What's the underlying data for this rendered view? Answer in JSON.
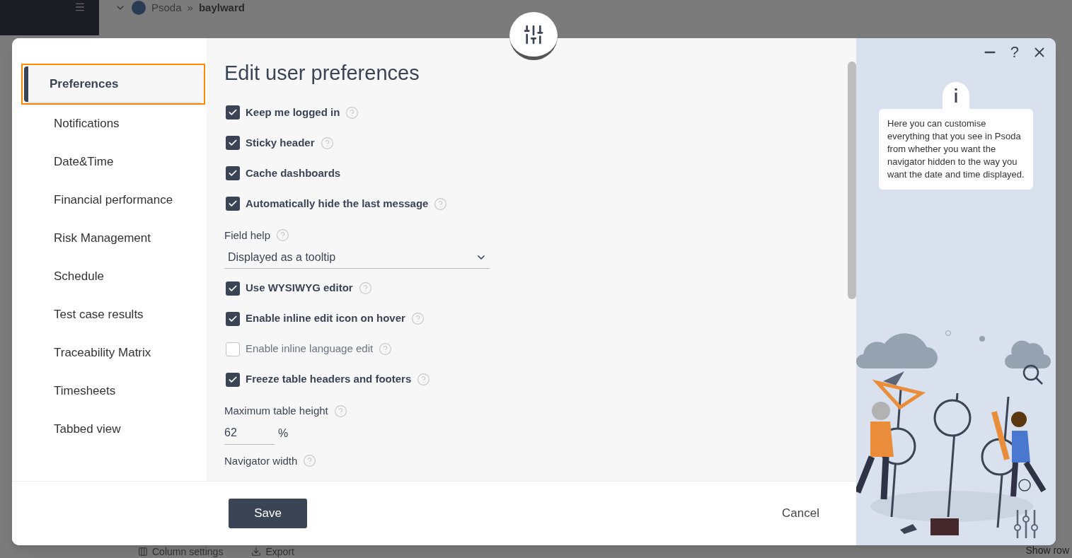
{
  "background": {
    "breadcrumb": [
      "Psoda",
      "»",
      "baylward"
    ],
    "toolbar": [
      "Column settings",
      "Export",
      "Show row"
    ]
  },
  "dialog": {
    "title": "Edit user preferences",
    "nav": [
      {
        "label": "Preferences",
        "selected": true
      },
      {
        "label": "Notifications",
        "selected": false
      },
      {
        "label": "Date&Time",
        "selected": false
      },
      {
        "label": "Financial performance",
        "selected": false
      },
      {
        "label": "Risk Management",
        "selected": false
      },
      {
        "label": "Schedule",
        "selected": false
      },
      {
        "label": "Test case results",
        "selected": false
      },
      {
        "label": "Traceability Matrix",
        "selected": false
      },
      {
        "label": "Timesheets",
        "selected": false
      },
      {
        "label": "Tabbed view",
        "selected": false
      }
    ],
    "fields": [
      {
        "kind": "checkbox",
        "label": "Keep me logged in",
        "checked": true,
        "help": true
      },
      {
        "kind": "checkbox",
        "label": "Sticky header",
        "checked": true,
        "help": true
      },
      {
        "kind": "checkbox",
        "label": "Cache dashboards",
        "checked": true,
        "help": false
      },
      {
        "kind": "checkbox",
        "label": "Automatically hide the last message",
        "checked": true,
        "help": true
      },
      {
        "kind": "select",
        "label": "Field help",
        "value": "Displayed as a tooltip",
        "help": true
      },
      {
        "kind": "checkbox",
        "label": "Use WYSIWYG editor",
        "checked": true,
        "help": true
      },
      {
        "kind": "checkbox",
        "label": "Enable inline edit icon on hover",
        "checked": true,
        "help": true
      },
      {
        "kind": "checkbox",
        "label": "Enable inline language edit",
        "checked": false,
        "help": true
      },
      {
        "kind": "checkbox",
        "label": "Freeze table headers and footers",
        "checked": true,
        "help": true
      },
      {
        "kind": "number",
        "label": "Maximum table height",
        "value": "62",
        "unit": "%",
        "help": true
      },
      {
        "kind": "label",
        "label": "Navigator width",
        "help": true
      }
    ],
    "buttons": {
      "save": "Save",
      "cancel": "Cancel"
    },
    "window_controls": {
      "help": "?"
    },
    "info": "Here you can customise everything that you see in Psoda from whether you want the navigator hidden to the way you want the date and time displayed."
  }
}
